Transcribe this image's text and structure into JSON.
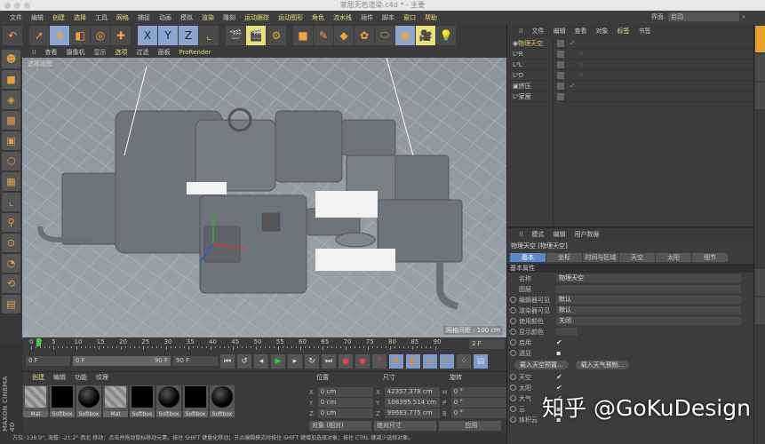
{
  "window": {
    "title": "家居无色渲染.c4d * - 主要"
  },
  "menu": [
    "文件",
    "编辑",
    "创建",
    "选择",
    "工具",
    "网格",
    "捕捉",
    "动画",
    "模拟",
    "渲染",
    "雕刻",
    "运动跟踪",
    "运动图形",
    "角色",
    "流水线",
    "插件",
    "脚本",
    "窗口",
    "帮助"
  ],
  "menu_highlight": [
    "创建",
    "选择",
    "网格",
    "渲染",
    "运动跟踪",
    "运动图形",
    "角色",
    "流水线",
    "窗口",
    "帮助"
  ],
  "layout": {
    "label": "界面:",
    "value": "启动"
  },
  "toolbar_icons": [
    "undo-icon",
    "select-icon",
    "move-icon",
    "scale-icon",
    "rotate-icon",
    "add-icon",
    "x-axis-icon",
    "y-axis-icon",
    "z-axis-icon",
    "coordinate-icon",
    "render-view-icon",
    "render-picture-viewer-icon",
    "render-settings-icon",
    "cube-icon",
    "pen-icon",
    "subdivision-icon",
    "cloner-icon",
    "deformer-icon",
    "floor-icon",
    "camera-icon",
    "light-icon"
  ],
  "viewport": {
    "menu": [
      "查看",
      "摄像机",
      "显示",
      "选项",
      "过滤",
      "面板",
      "ProRender"
    ],
    "menu_highlight": [
      "选项",
      "ProRender"
    ],
    "label": "透视视图",
    "grid": "网格间距 : 100 cm"
  },
  "timeline": {
    "ticks": [
      "0",
      "2",
      "5",
      "10",
      "15",
      "20",
      "25",
      "30",
      "35",
      "40",
      "45",
      "50",
      "55",
      "60",
      "65",
      "70",
      "75",
      "80",
      "85",
      "90"
    ],
    "current": "2 F",
    "start": "0 F",
    "range_start": "0 F",
    "range_end": "90 F",
    "end": "90 F"
  },
  "materials": {
    "tabs": [
      "创建",
      "编辑",
      "功能",
      "纹理"
    ],
    "items": [
      {
        "name": "Mat",
        "type": "stripe"
      },
      {
        "name": "Softbox",
        "type": "black"
      },
      {
        "name": "Softbox",
        "type": "sphere"
      },
      {
        "name": "Mat",
        "type": "stripe"
      },
      {
        "name": "Softbox",
        "type": "black"
      },
      {
        "name": "Softbox",
        "type": "sphere"
      },
      {
        "name": "Softbox",
        "type": "black"
      },
      {
        "name": "Softbox",
        "type": "sphere"
      }
    ]
  },
  "brand": "MAXON CINEMA 4D",
  "coords": {
    "headers": [
      "位置",
      "尺寸",
      "旋转"
    ],
    "rows": [
      {
        "a": "X",
        "pos": "0 cm",
        "s": "X",
        "size": "42357.378 cm",
        "r": "H",
        "rot": "0 °"
      },
      {
        "a": "Y",
        "pos": "0 cm",
        "s": "Y",
        "size": "108395.514 cm",
        "r": "P",
        "rot": "0 °"
      },
      {
        "a": "Z",
        "pos": "0 cm",
        "s": "Z",
        "size": "99683.775 cm",
        "r": "B",
        "rot": "0 °"
      }
    ],
    "mode": "对象 (相对)",
    "size_mode": "绝对尺寸",
    "apply": "应用"
  },
  "status": "方位: 139.9°, 海拔: -21.2° 西北    移动：点击并拖动鼠标移动元素。按住 SHIFT 键量化移动；节点编辑模式时按住 SHIFT 键增加选择对象；按住 CTRL 键减少选择对象。",
  "objects": {
    "menu": [
      "文件",
      "编辑",
      "查看",
      "对象",
      "标签",
      "书签"
    ],
    "menu_highlight": [
      "标签"
    ],
    "items": [
      {
        "name": "物理天空",
        "selected": true,
        "check": true
      },
      {
        "name": "R"
      },
      {
        "name": "L"
      },
      {
        "name": "D"
      },
      {
        "name": "挤压",
        "check": true
      },
      {
        "name": "家居"
      }
    ]
  },
  "attributes": {
    "menu": [
      "模式",
      "编辑",
      "用户数据"
    ],
    "title": "物理天空 [物理天空]",
    "tabs": [
      "基本",
      "坐标",
      "时间与区域",
      "天空",
      "太阳",
      "细节"
    ],
    "active_tab": "基本",
    "section": "基本属性",
    "rows": [
      {
        "label": "名称",
        "value": "物理天空"
      },
      {
        "label": "图层",
        "value": ""
      },
      {
        "label": "编辑器可见",
        "value": "默认"
      },
      {
        "label": "渲染器可见",
        "value": "默认"
      },
      {
        "label": "使用颜色",
        "value": "关闭"
      },
      {
        "label": "显示颜色",
        "value": ""
      }
    ],
    "checks1": [
      {
        "label": "启用",
        "checked": true
      },
      {
        "label": "透显",
        "checked": false
      }
    ],
    "buttons": [
      "载入天空预置...",
      "载入天气预制..."
    ],
    "checks2": [
      {
        "label": "天空",
        "checked": true
      },
      {
        "label": "太阳",
        "checked": true
      },
      {
        "label": "大气",
        "checked": true
      },
      {
        "label": "云",
        "checked": false
      },
      {
        "label": "体积云",
        "checked": false
      }
    ]
  },
  "watermark": "知乎 @GoKuDesign"
}
